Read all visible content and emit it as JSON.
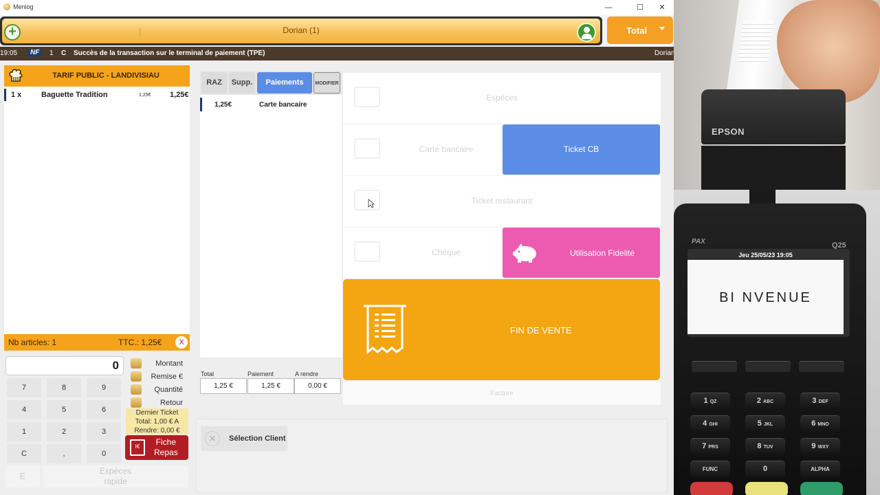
{
  "window": {
    "title": "Menlog",
    "controls": [
      "—",
      "☐",
      "✕"
    ]
  },
  "client_bar": {
    "name": "Dorian (1)",
    "total_label": "Total"
  },
  "status": {
    "time": "19:05",
    "badge": "NF",
    "count": "1",
    "flag": "C",
    "message": "Succès de la transaction sur le terminal de paiement (TPE)",
    "user": "Dorian"
  },
  "ticket": {
    "header": "TARIF PUBLIC - LANDIVISIAU",
    "lines": [
      {
        "qty": "1 x",
        "name": "Baguette Tradition",
        "unit_price": "1,25€",
        "total": "1,25€"
      }
    ],
    "nb_articles": "Nb articles: 1",
    "ttc": "TTC.: 1,25€",
    "close": "X"
  },
  "numpad": {
    "display": "0",
    "keys": [
      "7",
      "8",
      "9",
      "4",
      "5",
      "6",
      "1",
      "2",
      "3",
      "C",
      ",",
      "0"
    ],
    "functions": [
      "Montant",
      "Remise €",
      "Quantité",
      "Retour"
    ],
    "last_ticket": [
      "Dernier Ticket",
      "Total: 1,00 € A",
      "Rendre: 0,00 €"
    ],
    "fiche_repas": [
      "Fiche",
      "Repas"
    ],
    "fiche_icon_text": "I€",
    "e_label": "E",
    "especes_rapide": [
      "Espèces",
      "rapide"
    ]
  },
  "payments": {
    "tabs": {
      "raz": "RAZ",
      "supp": "Supp.",
      "paiements": "Paiements",
      "modifier": "MODIFIER"
    },
    "lines": [
      {
        "amount": "1,25€",
        "method": "Carte bancaire"
      }
    ],
    "totals": {
      "labels": [
        "Total",
        "Paiement",
        "A rendre"
      ],
      "values": [
        "1,25 €",
        "1,25 €",
        "0,00 €"
      ]
    },
    "infos_client_label": "Infos Client",
    "select_client": "Sélection Client"
  },
  "pay_buttons": {
    "especes": "Espèces",
    "carte_bancaire": "Carte bancaire",
    "ticket_cb": "Ticket CB",
    "ticket_restaurant": "Ticket restaurant",
    "cheque": "Chèque",
    "utilisation_fidelite": "Utilisation Fidelité",
    "fin_de_vente": "FIN DE VENTE",
    "facture": "Facture"
  },
  "printer": {
    "brand": "EPSON"
  },
  "terminal": {
    "brand": "PAX",
    "model": "Q25",
    "date": "Jeu 25/05/23 19:05",
    "message": "BI   NVENUE",
    "keys": [
      {
        "n": "1",
        "s": "QZ"
      },
      {
        "n": "2",
        "s": "ABC"
      },
      {
        "n": "3",
        "s": "DEF"
      },
      {
        "n": "4",
        "s": "GHI"
      },
      {
        "n": "5",
        "s": "JKL"
      },
      {
        "n": "6",
        "s": "MNO"
      },
      {
        "n": "7",
        "s": "PRS"
      },
      {
        "n": "8",
        "s": "TUV"
      },
      {
        "n": "9",
        "s": "WXY"
      },
      {
        "n": "FUNC",
        "s": ""
      },
      {
        "n": "0",
        "s": ""
      },
      {
        "n": "ALPHA",
        "s": ""
      }
    ],
    "colors": {
      "cancel": "#d23b3b",
      "clear": "#e8e27a",
      "enter": "#2f9a6a"
    }
  },
  "colors": {
    "accent_orange": "#f4a024",
    "blue": "#5b8de6",
    "pink": "#ec5bb0",
    "red": "#b41c24"
  }
}
